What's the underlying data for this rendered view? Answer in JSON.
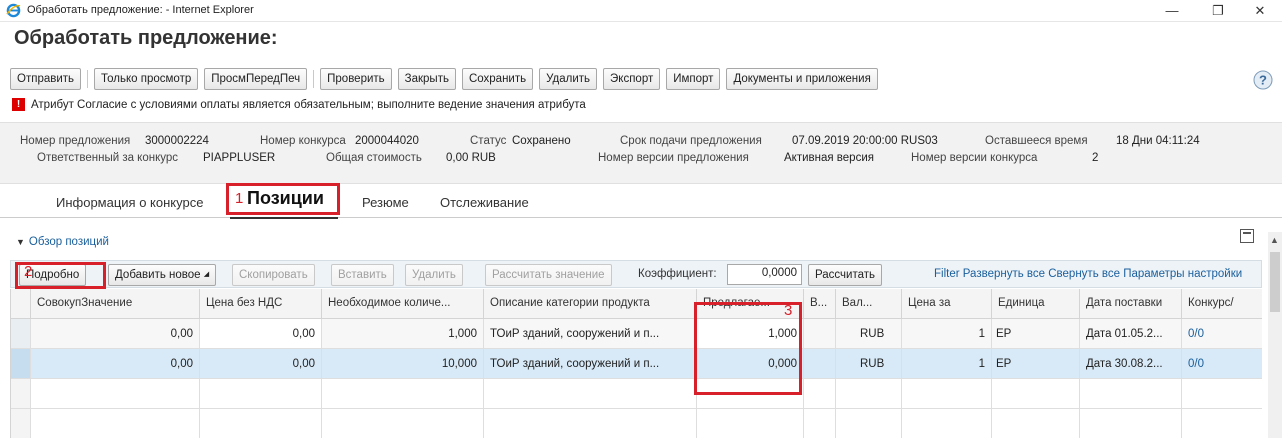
{
  "window": {
    "title": "Обработать предложение: - Internet Explorer",
    "controls": [
      "—",
      "❐",
      "✕"
    ]
  },
  "page": {
    "title": "Обработать предложение:"
  },
  "toolbar": {
    "buttons": [
      "Отправить",
      "Только просмотр",
      "ПросмПередПеч",
      "Проверить",
      "Закрыть",
      "Сохранить",
      "Удалить",
      "Экспорт",
      "Импорт",
      "Документы и приложения"
    ]
  },
  "message": {
    "text": "Атрибут Согласие с условиями оплаты является обязательным; выполните ведение значения атрибута"
  },
  "header": {
    "offer_number_label": "Номер предложения",
    "offer_number": "3000002224",
    "tender_number_label": "Номер конкурса",
    "tender_number": "2000044020",
    "status_label": "Статус",
    "status": "Сохранено",
    "deadline_label": "Срок подачи предложения",
    "deadline": "07.09.2019 20:00:00 RUS03",
    "remaining_label": "Оставшееся время",
    "remaining": "18 Дни 04:11:24",
    "responsible_label": "Ответственный за конкурс",
    "responsible": "PIAPPLUSER",
    "total_label": "Общая стоимость",
    "total": "0,00 RUB",
    "offer_version_label": "Номер версии предложения",
    "offer_version": "Активная версия",
    "tender_version_label": "Номер версии конкурса",
    "tender_version": "2"
  },
  "tabs": [
    "Информация о конкурсе",
    "Позиции",
    "Резюме",
    "Отслеживание"
  ],
  "annotations": [
    "1",
    "2",
    "3"
  ],
  "section": {
    "title": "Обзор позиций"
  },
  "table_toolbar": {
    "details": "Подробно",
    "add_new": "Добавить новое",
    "copy": "Скопировать",
    "insert": "Вставить",
    "delete": "Удалить",
    "calc_value": "Рассчитать значение",
    "coef_label": "Коэффициент:",
    "coef_value": "0,0000",
    "calc": "Рассчитать",
    "links": [
      "Filter",
      "Развернуть все",
      "Свернуть все",
      "Параметры настройки"
    ]
  },
  "grid": {
    "columns": [
      "СовокупЗначение",
      "Цена без НДС",
      "Необходимое количе...",
      "Описание категории продукта",
      "Предлагае...",
      "В...",
      "Вал...",
      "Цена за",
      "Единица",
      "Дата поставки",
      "Конкурс/"
    ],
    "rows": [
      [
        "0,00",
        "0,00",
        "1,000",
        "ТОиР зданий, сооружений и п...",
        "1,000",
        "",
        "RUB",
        "1",
        "EP",
        "Дата 01.05.2...",
        "0/0"
      ],
      [
        "0,00",
        "0,00",
        "10,000",
        "ТОиР зданий, сооружений и п...",
        "0,000",
        "",
        "RUB",
        "1",
        "EP",
        "Дата 30.08.2...",
        "0/0"
      ]
    ]
  },
  "colors": {
    "accent_red": "#d7202a",
    "link_blue": "#1a5f9c",
    "selected_row": "#d8eaf7"
  }
}
